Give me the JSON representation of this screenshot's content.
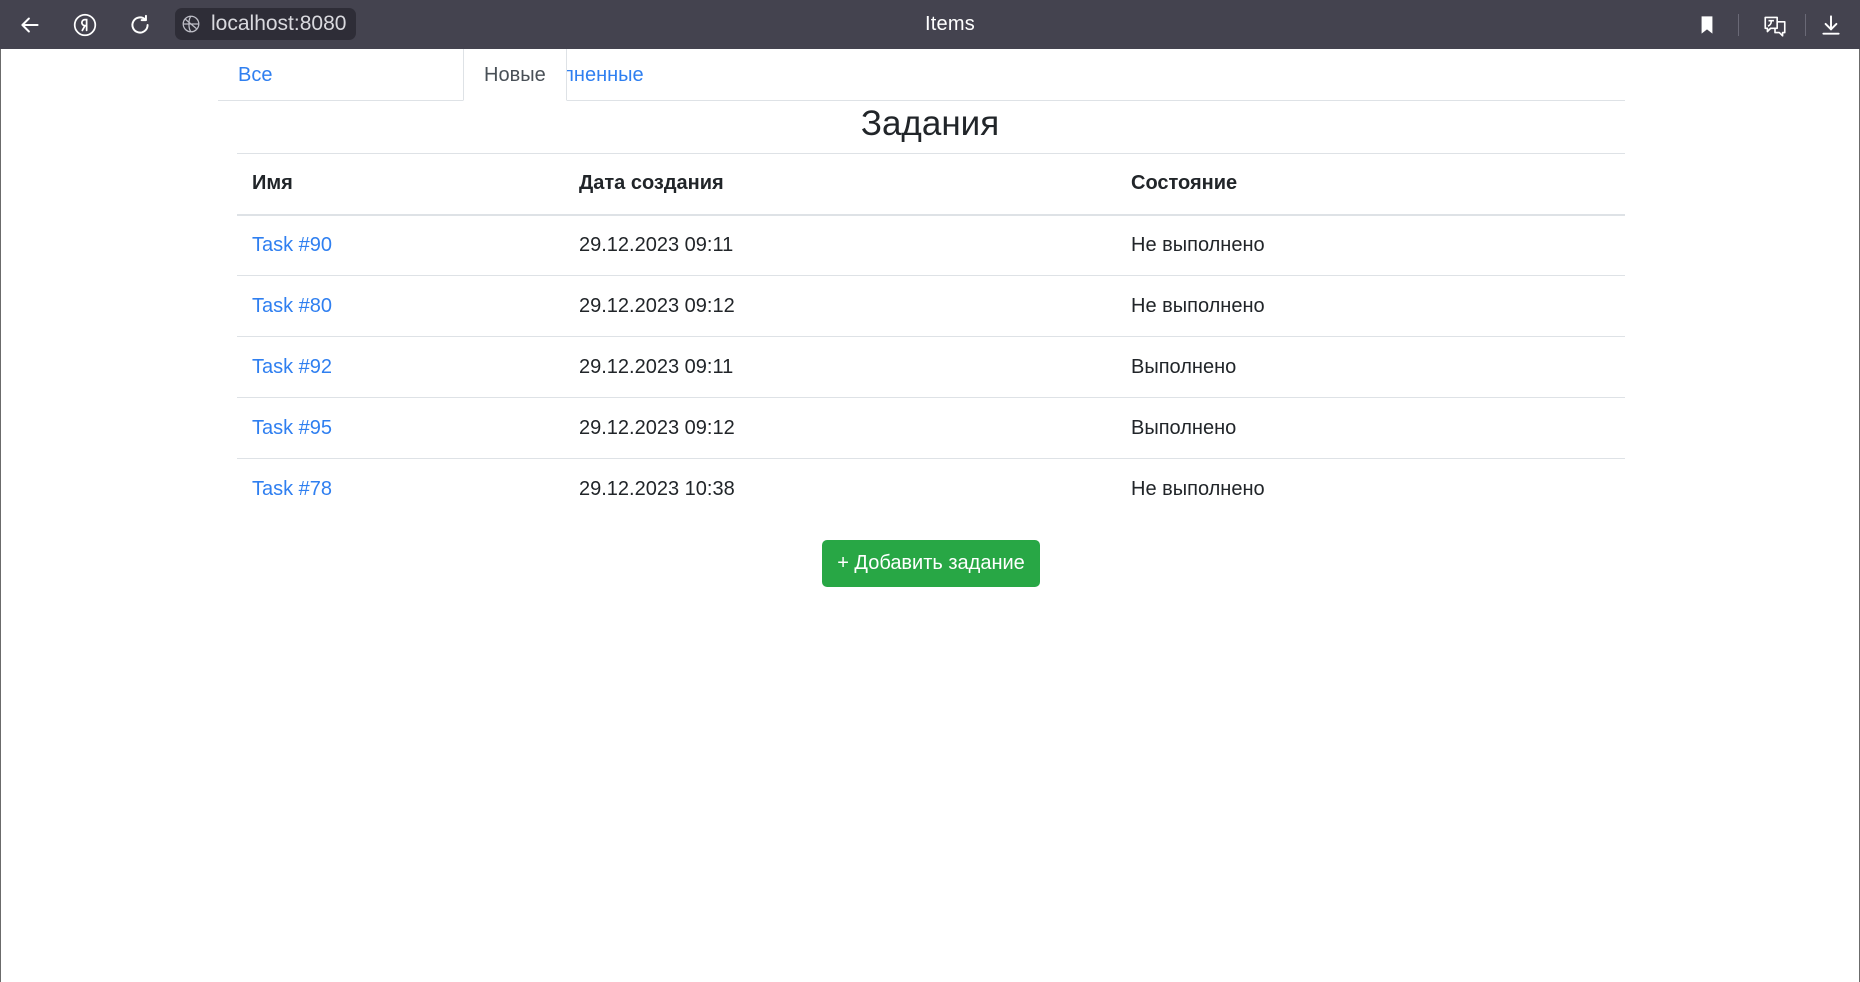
{
  "browser": {
    "url": "localhost:8080",
    "tab_title": "Items",
    "icons": [
      "back-arrow-icon",
      "yandex-logo-icon",
      "reload-icon",
      "site-info-icon",
      "bookmark-icon",
      "translate-icon",
      "download-icon"
    ]
  },
  "tabs": [
    {
      "label": "Все",
      "active": false
    },
    {
      "label": "Выполненные",
      "active": false
    },
    {
      "label": "Новые",
      "active": true
    }
  ],
  "page": {
    "title": "Задания"
  },
  "table": {
    "headers": [
      "Имя",
      "Дата создания",
      "Состояние"
    ],
    "rows": [
      {
        "name": "Task #90",
        "created": "29.12.2023 09:11",
        "status": "Не выполнено"
      },
      {
        "name": "Task #80",
        "created": "29.12.2023 09:12",
        "status": "Не выполнено"
      },
      {
        "name": "Task #92",
        "created": "29.12.2023 09:11",
        "status": "Выполнено"
      },
      {
        "name": "Task #95",
        "created": "29.12.2023 09:12",
        "status": "Выполнено"
      },
      {
        "name": "Task #78",
        "created": "29.12.2023 10:38",
        "status": "Не выполнено"
      }
    ]
  },
  "actions": {
    "add_label": "+ Добавить задание"
  },
  "colors": {
    "browser_bar": "#44434f",
    "link": "#2f7ff0",
    "success": "#28a745"
  }
}
